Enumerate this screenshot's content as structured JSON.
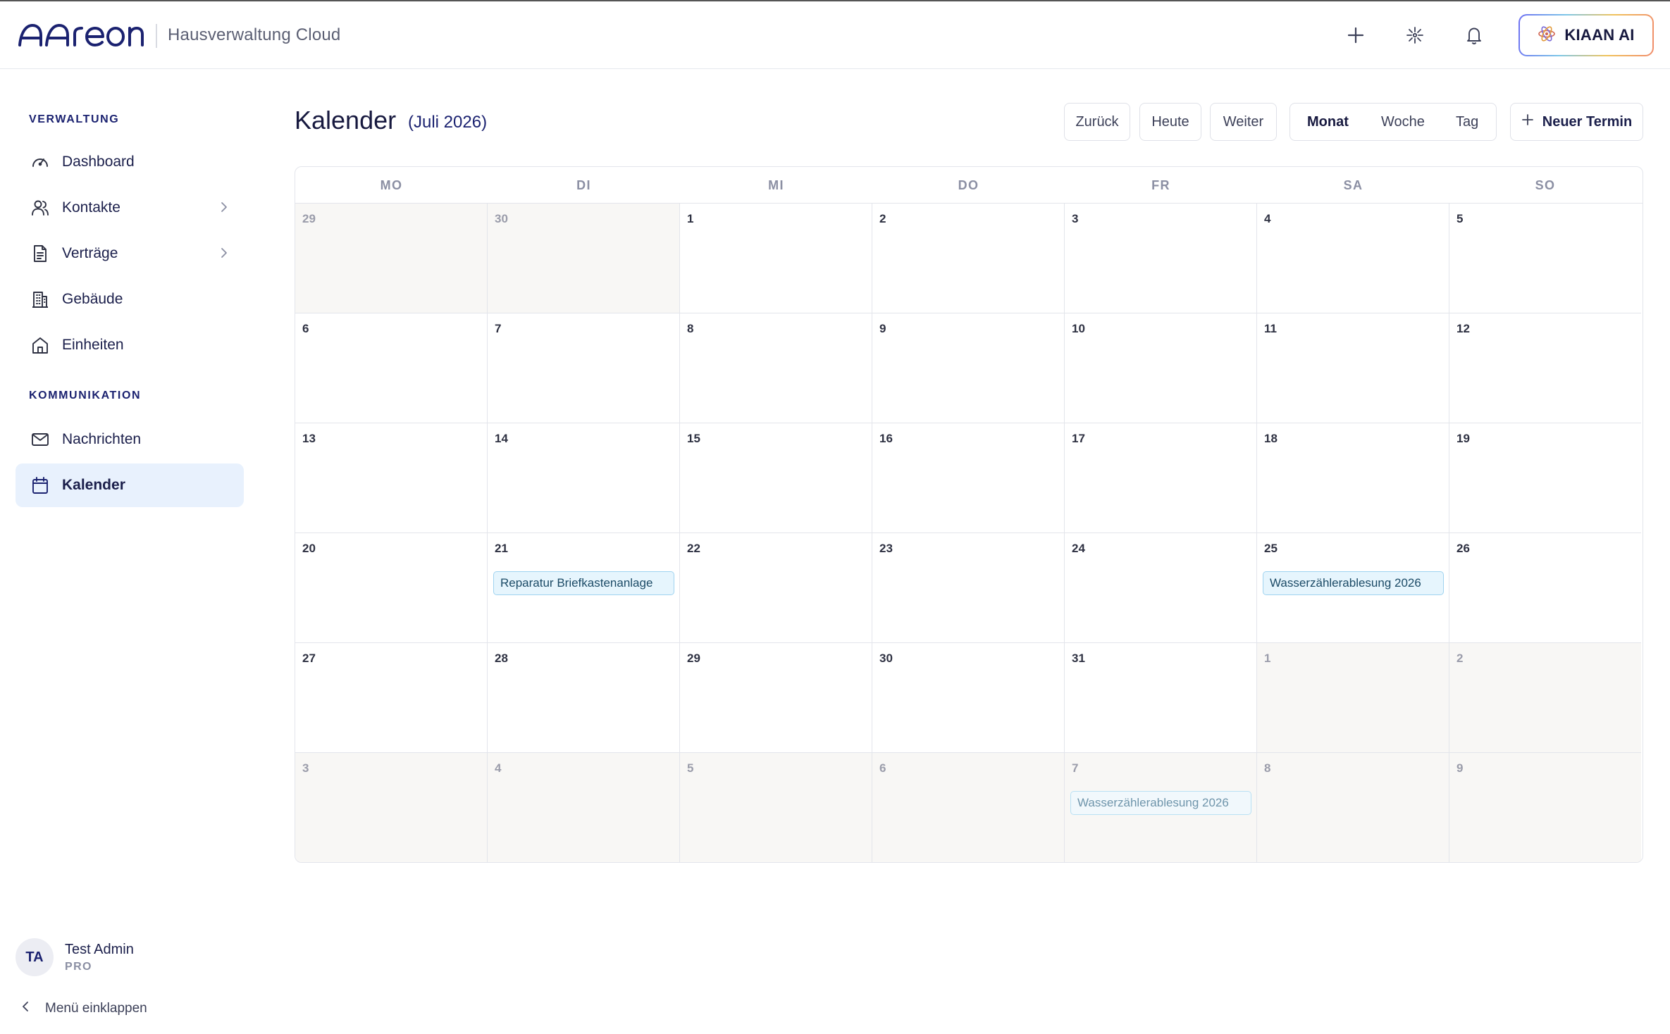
{
  "app": {
    "brand": "Aareon",
    "product": "Hausverwaltung Cloud",
    "ai_label": "KIAAN AI",
    "icons": [
      "plus-icon",
      "sparkle-icon",
      "bell-icon"
    ]
  },
  "sidebar": {
    "sections": [
      {
        "title": "VERWALTUNG",
        "items": [
          {
            "label": "Dashboard",
            "icon": "gauge-icon"
          },
          {
            "label": "Kontakte",
            "icon": "users-icon",
            "chevron": true
          },
          {
            "label": "Verträge",
            "icon": "document-icon",
            "chevron": true
          },
          {
            "label": "Gebäude",
            "icon": "building-icon"
          },
          {
            "label": "Einheiten",
            "icon": "home-icon"
          }
        ]
      },
      {
        "title": "KOMMUNIKATION",
        "items": [
          {
            "label": "Nachrichten",
            "icon": "mail-icon"
          },
          {
            "label": "Kalender",
            "icon": "calendar-icon",
            "active": true
          }
        ]
      }
    ],
    "user": {
      "initials": "TA",
      "name": "Test Admin",
      "plan": "PRO"
    },
    "collapse_label": "Menü einklappen"
  },
  "header": {
    "title": "Kalender",
    "subtitle": "(Juli 2026)",
    "back_label": "Zurück",
    "today_label": "Heute",
    "next_label": "Weiter",
    "views": [
      "Monat",
      "Woche",
      "Tag"
    ],
    "active_view": "Monat",
    "new_label": "Neuer Termin"
  },
  "calendar": {
    "weekdays": [
      "MO",
      "DI",
      "MI",
      "DO",
      "FR",
      "SA",
      "SO"
    ],
    "weeks": [
      [
        {
          "d": "29",
          "muted": true
        },
        {
          "d": "30",
          "muted": true
        },
        {
          "d": "1"
        },
        {
          "d": "2"
        },
        {
          "d": "3"
        },
        {
          "d": "4"
        },
        {
          "d": "5"
        }
      ],
      [
        {
          "d": "6"
        },
        {
          "d": "7"
        },
        {
          "d": "8"
        },
        {
          "d": "9"
        },
        {
          "d": "10"
        },
        {
          "d": "11"
        },
        {
          "d": "12"
        }
      ],
      [
        {
          "d": "13"
        },
        {
          "d": "14"
        },
        {
          "d": "15"
        },
        {
          "d": "16"
        },
        {
          "d": "17"
        },
        {
          "d": "18"
        },
        {
          "d": "19"
        }
      ],
      [
        {
          "d": "20"
        },
        {
          "d": "21",
          "event": "Reparatur Briefkastenanlage"
        },
        {
          "d": "22"
        },
        {
          "d": "23"
        },
        {
          "d": "24"
        },
        {
          "d": "25",
          "event": "Wasserzählerablesung 2026"
        },
        {
          "d": "26"
        }
      ],
      [
        {
          "d": "27"
        },
        {
          "d": "28"
        },
        {
          "d": "29"
        },
        {
          "d": "30"
        },
        {
          "d": "31"
        },
        {
          "d": "1",
          "muted": true
        },
        {
          "d": "2",
          "muted": true
        }
      ],
      [
        {
          "d": "3",
          "muted": true
        },
        {
          "d": "4",
          "muted": true
        },
        {
          "d": "5",
          "muted": true
        },
        {
          "d": "6",
          "muted": true
        },
        {
          "d": "7",
          "muted": true,
          "event": "Wasserzählerablesung 2026"
        },
        {
          "d": "8",
          "muted": true
        },
        {
          "d": "9",
          "muted": true
        }
      ]
    ]
  }
}
